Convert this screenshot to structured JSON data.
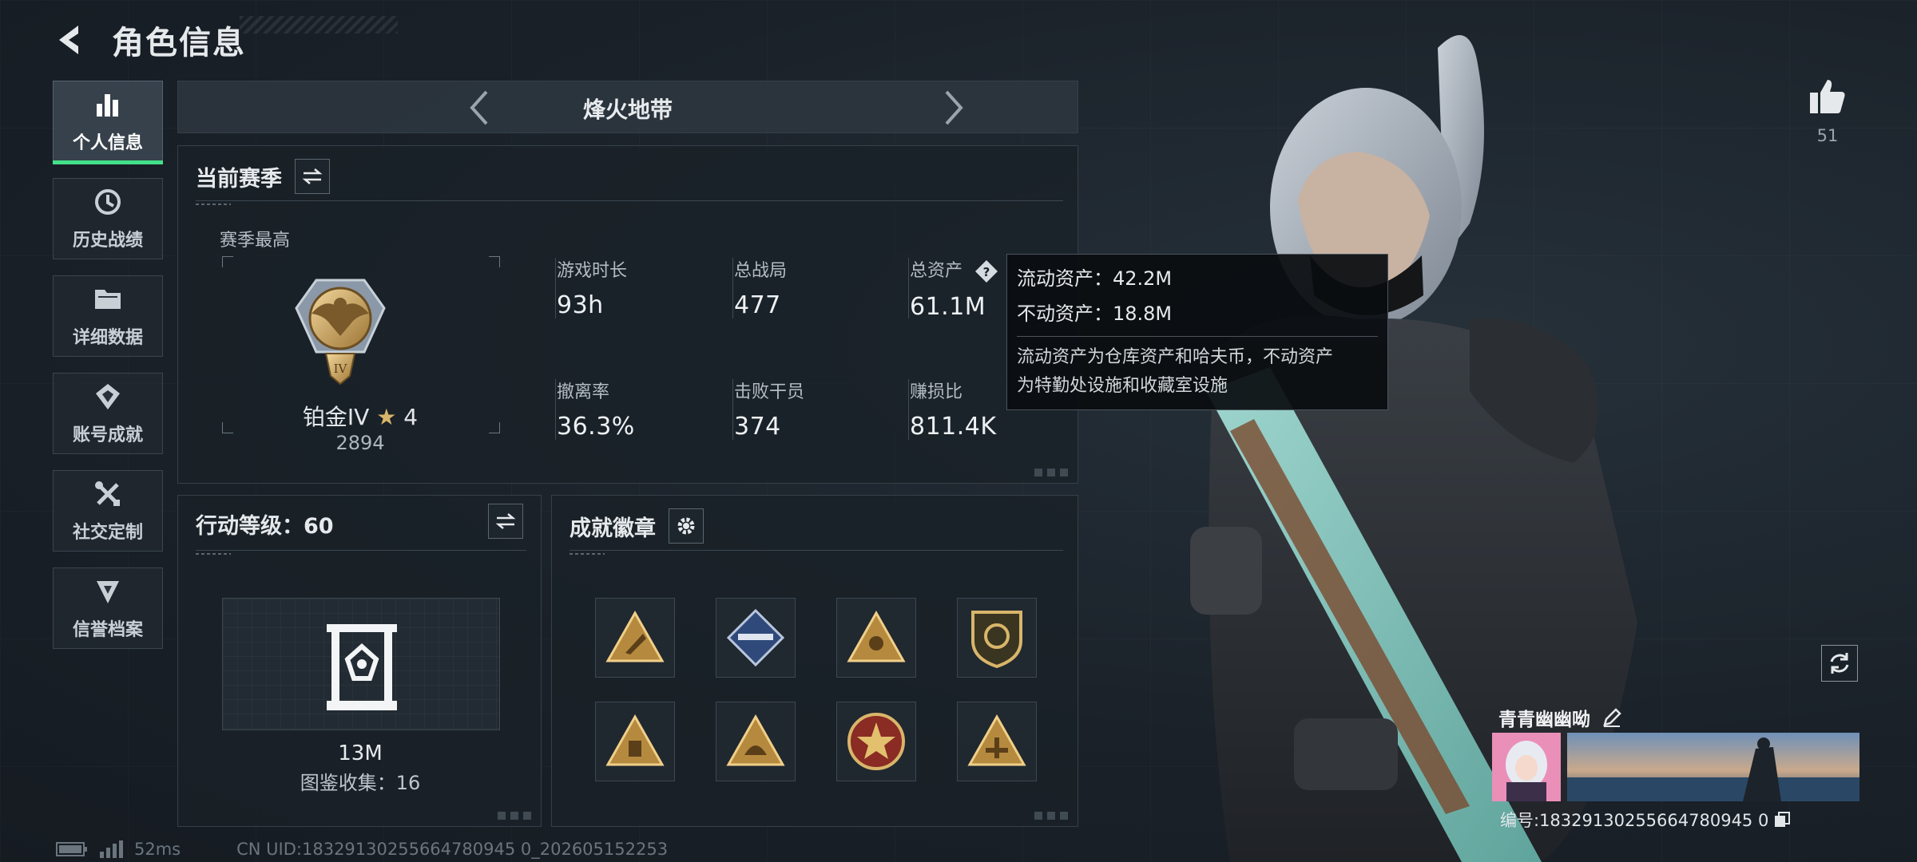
{
  "header": {
    "title": "角色信息"
  },
  "sidebar": {
    "items": [
      {
        "label": "个人信息",
        "icon": "bar-chart-icon",
        "active": true
      },
      {
        "label": "历史战绩",
        "icon": "history-icon"
      },
      {
        "label": "详细数据",
        "icon": "folder-icon"
      },
      {
        "label": "账号成就",
        "icon": "achievement-icon"
      },
      {
        "label": "社交定制",
        "icon": "tools-icon"
      },
      {
        "label": "信誉档案",
        "icon": "credit-icon"
      }
    ]
  },
  "mode": {
    "name": "烽火地带"
  },
  "season": {
    "title": "当前赛季",
    "best_label": "赛季最高",
    "rank_name": "铂金IV",
    "rank_stars": "4",
    "rank_score": "2894",
    "stats": [
      {
        "label": "游戏时长",
        "value": "93h"
      },
      {
        "label": "总战局",
        "value": "477"
      },
      {
        "label": "总资产",
        "value": "61.1M"
      },
      {
        "label": "撤离率",
        "value": "36.3%"
      },
      {
        "label": "击败干员",
        "value": "374"
      },
      {
        "label": "赚损比",
        "value": "811.4K"
      }
    ]
  },
  "tooltip": {
    "liquid": "流动资产：42.2M",
    "fixed": "不动资产：18.8M",
    "desc_line1": "流动资产为仓库资产和哈夫币，不动资产",
    "desc_line2": "为特勤处设施和收藏室设施"
  },
  "level": {
    "title": "行动等级：60",
    "value": "13M",
    "collection": "图鉴收集：16"
  },
  "achievements": {
    "title": "成就徽章",
    "badges": [
      "badge-1",
      "badge-2",
      "badge-3",
      "badge-4",
      "badge-5",
      "badge-6",
      "badge-7",
      "badge-8"
    ]
  },
  "footer": {
    "ping": "52ms",
    "uid": "CN UID:18329130255664780945 0_202605152253"
  },
  "profile": {
    "likes": "51",
    "name": "青青幽幽呦",
    "id": "编号:18329130255664780945 0"
  },
  "colors": {
    "accent": "#43e08a",
    "gold": "#d8b56a",
    "bg": "#1a2129"
  }
}
